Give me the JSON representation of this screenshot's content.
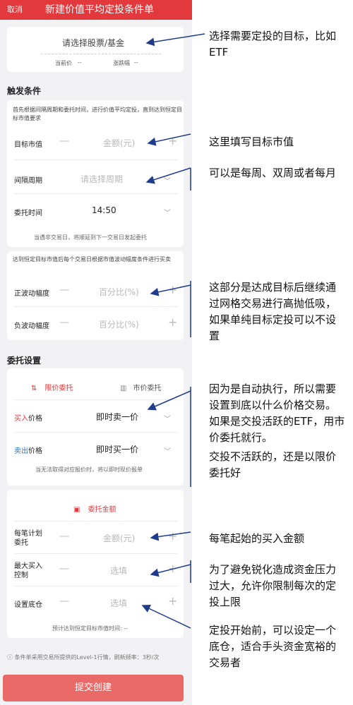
{
  "header": {
    "cancel": "取消",
    "title": "新建价值平均定投条件单"
  },
  "target": {
    "placeholder": "请选择股票/基金",
    "current_price_label": "当前价",
    "current_price_value": "--",
    "change_label": "涨跌幅",
    "change_value": "--"
  },
  "trigger": {
    "section_title": "触发条件",
    "desc": "首先根据间隔周期和委托时间，进行价值平均定投，直到达到恒定目标市值要求",
    "target_value": {
      "label": "目标市值",
      "placeholder": "金额(元)"
    },
    "period": {
      "label": "间隔周期",
      "placeholder": "请选择周期"
    },
    "time": {
      "label": "委托时间",
      "value": "14:50"
    },
    "note": "当遇非交易日，将顺延到下一交易日发起委托"
  },
  "fluct": {
    "desc": "达到恒定目标市值后每个交易日根据市值波动幅度条件进行买卖",
    "pos": {
      "label": "正波动幅度",
      "placeholder": "百分比(%)"
    },
    "neg": {
      "label": "负波动幅度",
      "placeholder": "百分比(%)"
    }
  },
  "order": {
    "section_title": "委托设置",
    "tab_limit": "限价委托",
    "tab_market": "市价委托",
    "buy_price": {
      "label_colored": "买入",
      "label_rest": "价格",
      "value": "即时卖一价"
    },
    "sell_price": {
      "label_colored": "卖出",
      "label_rest": "价格",
      "value": "即时买一价"
    },
    "note": "当无法取得对应报价时，将以即时现价报单"
  },
  "amount": {
    "title": "委托金额",
    "per": {
      "label_line1": "每笔计划",
      "label_line2": "委托",
      "placeholder": "金额(元)"
    },
    "max_buy": {
      "label_line1": "最大买入",
      "label_line2": "控制",
      "placeholder": "选填"
    },
    "base": {
      "label": "设置底仓",
      "placeholder": "选填"
    },
    "estimate": "预计达到恒定目标市值时间: --"
  },
  "footer_note": "条件单采用交易所提供的Level-1行情，刷新频率：3秒/次",
  "submit_label": "提交创建",
  "annotations": {
    "a1": "选择需要定投的目标，比如ETF",
    "a2": "这里填写目标市值",
    "a3": "可以是每周、双周或者每月",
    "a4": "这部分是达成目标后继续通过网格交易进行高抛低吸，如果单纯目标定投可以不设置",
    "a5a": "因为是自动执行，所以需要设置到底以什么价格交易。如果是交投活跃的ETF，用市价委托就行。",
    "a5b": "交投不活跃的，还是以限价委托好",
    "a6": "每笔起始的买入金额",
    "a7": "为了避免锐化造成资金压力过大，允许你限制每次的定投上限",
    "a8": "定投开始前，可以设定一个底仓，适合手头资金宽裕的交易者"
  },
  "colors": {
    "brand_red": "#e4393c",
    "submit": "#ea6a68",
    "sell_blue": "#2a72c8",
    "arrow": "#1f3b8c"
  }
}
